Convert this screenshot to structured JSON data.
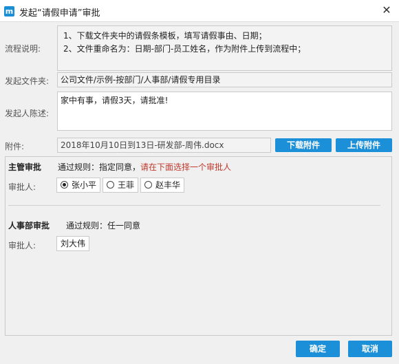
{
  "window": {
    "title": "发起“请假申请”审批",
    "logo_letter": "m"
  },
  "form": {
    "flow_label": "流程说明:",
    "flow_lines": [
      "1、下载文件夹中的请假条模板，填写请假事由、日期；",
      "2、文件重命名为：日期-部门-员工姓名，作为附件上传到流程中；"
    ],
    "folder_label": "发起文件夹:",
    "folder_value": "公司文件/示例-按部门/人事部/请假专用目录",
    "desc_label": "发起人陈述:",
    "desc_value": "家中有事，请假3天，请批准!",
    "attach_label": "附件:",
    "attach_value": "2018年10月10日到13日-研发部-周伟.docx",
    "download_label": "下载附件",
    "upload_label": "上传附件"
  },
  "approvals": {
    "supervisor": {
      "title": "主管审批",
      "rule": "通过规则：指定同意，",
      "rule_hint": "请在下面选择一个审批人",
      "approver_label": "审批人:",
      "options": [
        {
          "name": "张小平",
          "selected": true
        },
        {
          "name": "王菲",
          "selected": false
        },
        {
          "name": "赵丰华",
          "selected": false
        }
      ]
    },
    "hr": {
      "title": "人事部审批",
      "rule": "通过规则：任一同意",
      "approver_label": "审批人:",
      "approver": "刘大伟"
    }
  },
  "footer": {
    "ok_label": "确定",
    "cancel_label": "取消"
  },
  "colors": {
    "accent": "#1b8fd8",
    "hint_red": "#c0392b"
  }
}
